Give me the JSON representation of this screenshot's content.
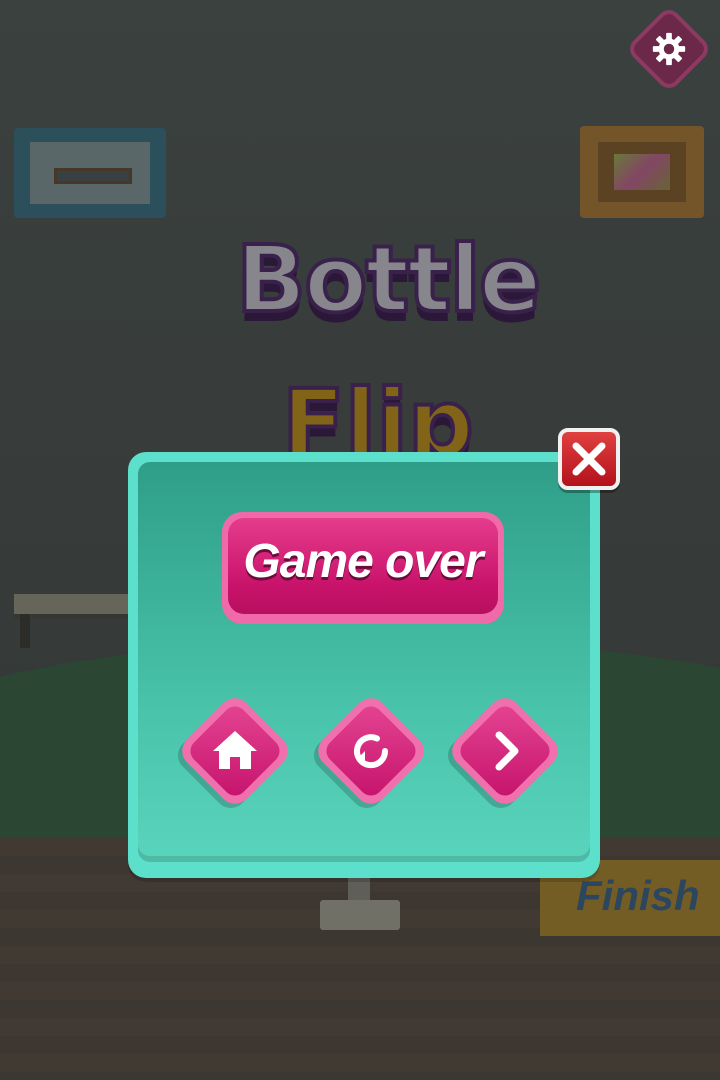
{
  "background": {
    "title_line1": "Bottle",
    "title_line2": "Flip",
    "finish_sign": "Finish"
  },
  "toolbar": {
    "settings_icon": "gear-icon"
  },
  "dialog": {
    "title": "Game over",
    "close_icon": "close-x-icon",
    "buttons": [
      {
        "name": "home",
        "icon": "home-icon"
      },
      {
        "name": "retry",
        "icon": "restart-icon"
      },
      {
        "name": "next",
        "icon": "chevron-right-icon"
      }
    ]
  },
  "colors": {
    "accent_pink": "#d61f7a",
    "dialog_teal": "#5cdfcb",
    "close_red": "#c41d24"
  }
}
